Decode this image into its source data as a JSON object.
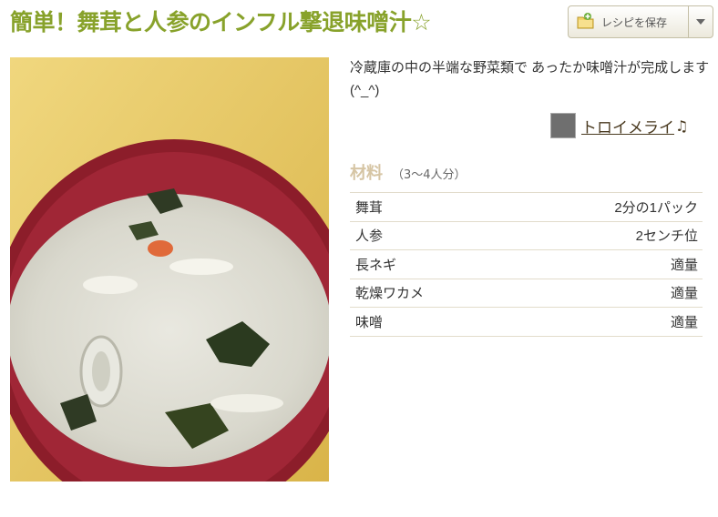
{
  "recipe": {
    "title": "簡単！舞茸と人参のインフル撃退味噌汁☆",
    "description": "冷蔵庫の中の半端な野菜類で あったか味噌汁が完成します(^_^)",
    "photo_icon": "miso-soup-photo"
  },
  "actions": {
    "save_label": "レシピを保存",
    "save_icon": "folder-add-icon",
    "dropdown_icon": "chevron-down-icon"
  },
  "author": {
    "name": "トロイメライ",
    "suffix": "♫"
  },
  "ingredients": {
    "heading": "材料",
    "servings": "（3〜4人分）",
    "items": [
      {
        "name": "舞茸",
        "amount": "2分の1パック"
      },
      {
        "name": "人参",
        "amount": "2センチ位"
      },
      {
        "name": "長ネギ",
        "amount": "適量"
      },
      {
        "name": "乾燥ワカメ",
        "amount": "適量"
      },
      {
        "name": "味噌",
        "amount": "適量"
      }
    ]
  },
  "colors": {
    "title": "#88a22b",
    "ingredient_heading": "#d6c5a4",
    "row_border": "#e2dccb"
  }
}
